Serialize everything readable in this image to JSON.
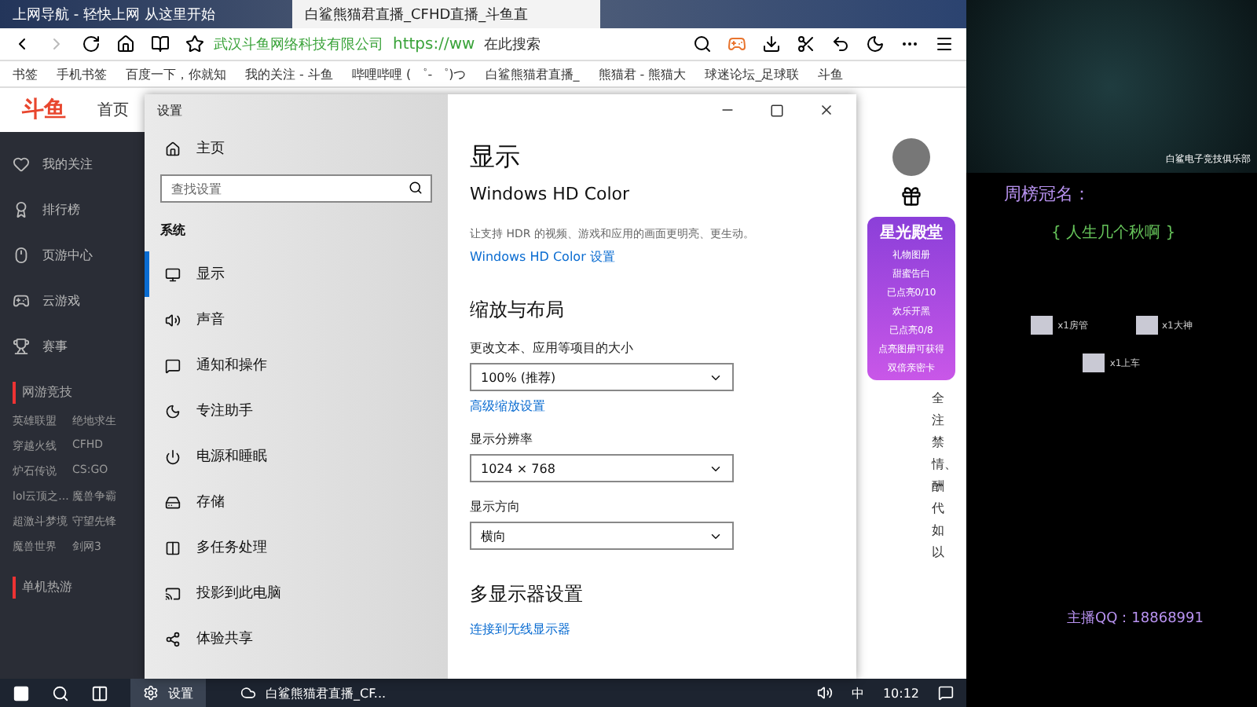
{
  "browser": {
    "tabs": [
      {
        "label": "上网导航 - 轻快上网 从这里开始",
        "selected": false
      },
      {
        "label": "白鲨熊猫君直播_CFHD直播_斗鱼直",
        "selected": true
      }
    ],
    "address": {
      "company": "武汉斗鱼网络科技有限公司",
      "url": "https://ww",
      "search_placeholder": "在此搜索"
    },
    "bookmarks": [
      "书签",
      "手机书签",
      "百度一下，你就知",
      "我的关注 - 斗鱼",
      "哔哩哔哩 ( ゜- ゜)つ",
      "白鲨熊猫君直播_",
      "熊猫君 - 熊猫大",
      "球迷论坛_足球联",
      "斗鱼"
    ]
  },
  "site": {
    "logo": "斗鱼",
    "nav": "首页",
    "sidebar": [
      {
        "label": "我的关注"
      },
      {
        "label": "排行榜"
      },
      {
        "label": "页游中心"
      },
      {
        "label": "云游戏"
      },
      {
        "label": "赛事"
      }
    ],
    "sections": [
      {
        "title": "网游竞技",
        "games": [
          "英雄联盟",
          "绝地求生",
          "穿越火线",
          "CFHD",
          "炉石传说",
          "CS:GO",
          "lol云顶之...",
          "魔兽争霸",
          "超激斗梦境",
          "守望先锋",
          "魔兽世界",
          "剑网3"
        ]
      },
      {
        "title": "单机热游"
      }
    ],
    "side_text": [
      "全",
      "注",
      "禁",
      "情、",
      "酬",
      "代",
      "如",
      "以"
    ],
    "promo": {
      "title": "星光殿堂",
      "header": "礼物图册",
      "items": [
        {
          "name": "甜蜜告白",
          "count": "已点亮0/10"
        },
        {
          "name": "欢乐开黑",
          "count": "已点亮0/8"
        }
      ],
      "footer": [
        "点亮图册可获得",
        "双倍亲密卡"
      ]
    }
  },
  "settings": {
    "title": "设置",
    "home": "主页",
    "search_placeholder": "查找设置",
    "group": "系统",
    "items": [
      {
        "label": "显示",
        "selected": true
      },
      {
        "label": "声音",
        "selected": false
      },
      {
        "label": "通知和操作",
        "selected": false
      },
      {
        "label": "专注助手",
        "selected": false
      },
      {
        "label": "电源和睡眠",
        "selected": false
      },
      {
        "label": "存储",
        "selected": false
      },
      {
        "label": "多任务处理",
        "selected": false
      },
      {
        "label": "投影到此电脑",
        "selected": false
      },
      {
        "label": "体验共享",
        "selected": false
      }
    ],
    "page_title": "显示",
    "hd_title": "Windows HD Color",
    "hd_desc": "让支持 HDR 的视频、游戏和应用的画面更明亮、更生动。",
    "hd_link": "Windows HD Color 设置",
    "scale_title": "缩放与布局",
    "scale_label": "更改文本、应用等项目的大小",
    "scale_value": "100% (推荐)",
    "scale_link": "高级缩放设置",
    "res_label": "显示分辨率",
    "res_value": "1024 × 768",
    "orient_label": "显示方向",
    "orient_value": "横向",
    "multi_title": "多显示器设置",
    "multi_link": "连接到无线显示器"
  },
  "taskbar": {
    "apps": [
      {
        "label": "设置",
        "selected": true
      },
      {
        "label": "白鲨熊猫君直播_CF...",
        "selected": false
      }
    ],
    "ime": "中",
    "time": "10:12"
  },
  "overlay": {
    "club": "白鲨电子竞技俱乐部",
    "sponsor_label": "周榜冠名：",
    "sponsor": "{ 人生几个秋啊 }",
    "gifts": [
      {
        "label": "x1房管"
      },
      {
        "label": "x1大神"
      },
      {
        "label": "x1上车"
      }
    ],
    "contact": "主播QQ：18868991"
  }
}
